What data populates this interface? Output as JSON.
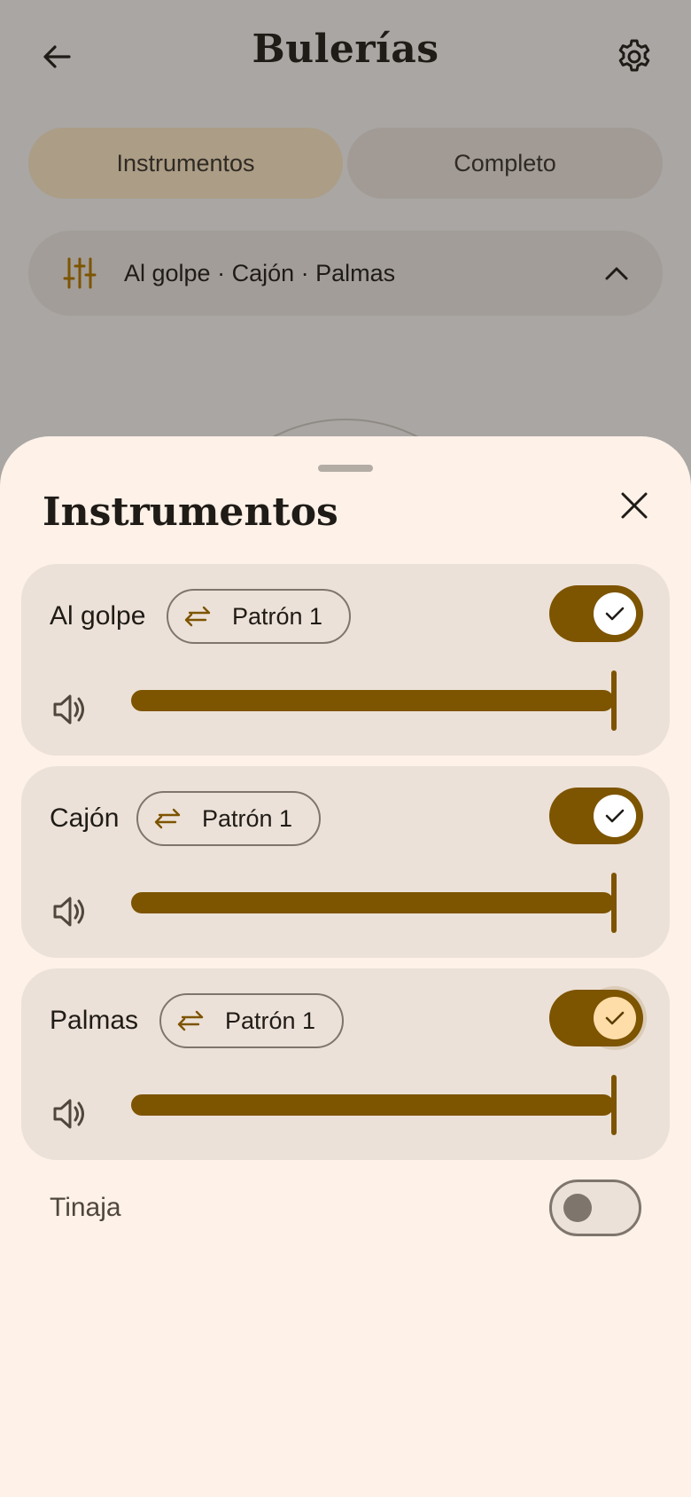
{
  "header": {
    "title": "Bulerías",
    "back_icon": "arrow-left-icon",
    "settings_icon": "gear-icon"
  },
  "tabs": [
    {
      "label": "Instrumentos",
      "selected": true
    },
    {
      "label": "Completo",
      "selected": false
    }
  ],
  "summary": {
    "icon": "sliders-icon",
    "text": "Al golpe · Cajón · Palmas",
    "chevron": "chevron-up-icon"
  },
  "sheet": {
    "title": "Instrumentos",
    "close_icon": "close-icon",
    "instruments": [
      {
        "name": "Al golpe",
        "pattern": "Patrón 1",
        "enabled": true,
        "volume": 1.0
      },
      {
        "name": "Cajón",
        "pattern": "Patrón 1",
        "enabled": true,
        "volume": 1.0
      },
      {
        "name": "Palmas",
        "pattern": "Patrón 1",
        "enabled": true,
        "volume": 1.0
      }
    ],
    "extra": {
      "name": "Tinaja",
      "enabled": false
    }
  },
  "colors": {
    "accent": "#7d5400",
    "scrim": "#a9a6a3",
    "sheet_bg": "#fdf1e8",
    "card_bg": "#ece1d8"
  }
}
